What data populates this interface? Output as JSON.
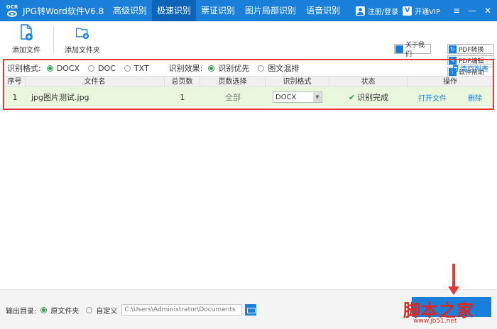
{
  "app": {
    "logo_text": "OCR",
    "title": "JPG转Word软件V6.8"
  },
  "tabs": [
    {
      "label": "高级识别",
      "active": false
    },
    {
      "label": "极速识别",
      "active": true
    },
    {
      "label": "票证识别",
      "active": false
    },
    {
      "label": "图片局部识别",
      "active": false
    },
    {
      "label": "语音识别",
      "active": false
    }
  ],
  "titlebar": {
    "login_label": "注册/登录",
    "vip_label": "开通VIP",
    "vip_icon": "V"
  },
  "window_controls": {
    "menu": "≡",
    "minimize": "—",
    "close": "✕"
  },
  "toolbar": {
    "add_file": "添加文件",
    "add_folder": "添加文件夹",
    "about": "关于我们"
  },
  "side_buttons": [
    {
      "icon": "refresh-icon",
      "glyph": "↻",
      "label": "PDF转换"
    },
    {
      "icon": "edit-icon",
      "glyph": "✎",
      "label": "PDF编辑"
    },
    {
      "icon": "help-icon",
      "glyph": "?",
      "label": "软件帮助"
    }
  ],
  "options": {
    "format_label": "识别格式:",
    "formats": [
      {
        "label": "DOCX",
        "selected": true
      },
      {
        "label": "DOC",
        "selected": false
      },
      {
        "label": "TXT",
        "selected": false
      }
    ],
    "effect_label": "识别效果:",
    "effects": [
      {
        "label": "识别优先",
        "selected": true
      },
      {
        "label": "图文混排",
        "selected": false
      }
    ],
    "clear_list": "清空列表"
  },
  "table": {
    "headers": [
      "序号",
      "文件名",
      "总页数",
      "页数选择",
      "识别格式",
      "状态",
      "操作"
    ],
    "rows": [
      {
        "index": "1",
        "filename": "jpg图片测试.jpg",
        "pages": "1",
        "page_select": "全部",
        "format": "DOCX",
        "status": "识别完成",
        "open_file": "打开文件",
        "delete": "删除"
      }
    ]
  },
  "output": {
    "label": "输出目录:",
    "original": "原文件夹",
    "custom": "自定义",
    "path_placeholder": "C:\\Users\\Administrator\\Documents",
    "original_selected": true
  },
  "colors": {
    "accent": "#1a7fd9",
    "highlight": "#e53935",
    "success": "#2e9e4a"
  },
  "watermark": {
    "text": "脚本之家",
    "url": "www.jb51.net"
  }
}
